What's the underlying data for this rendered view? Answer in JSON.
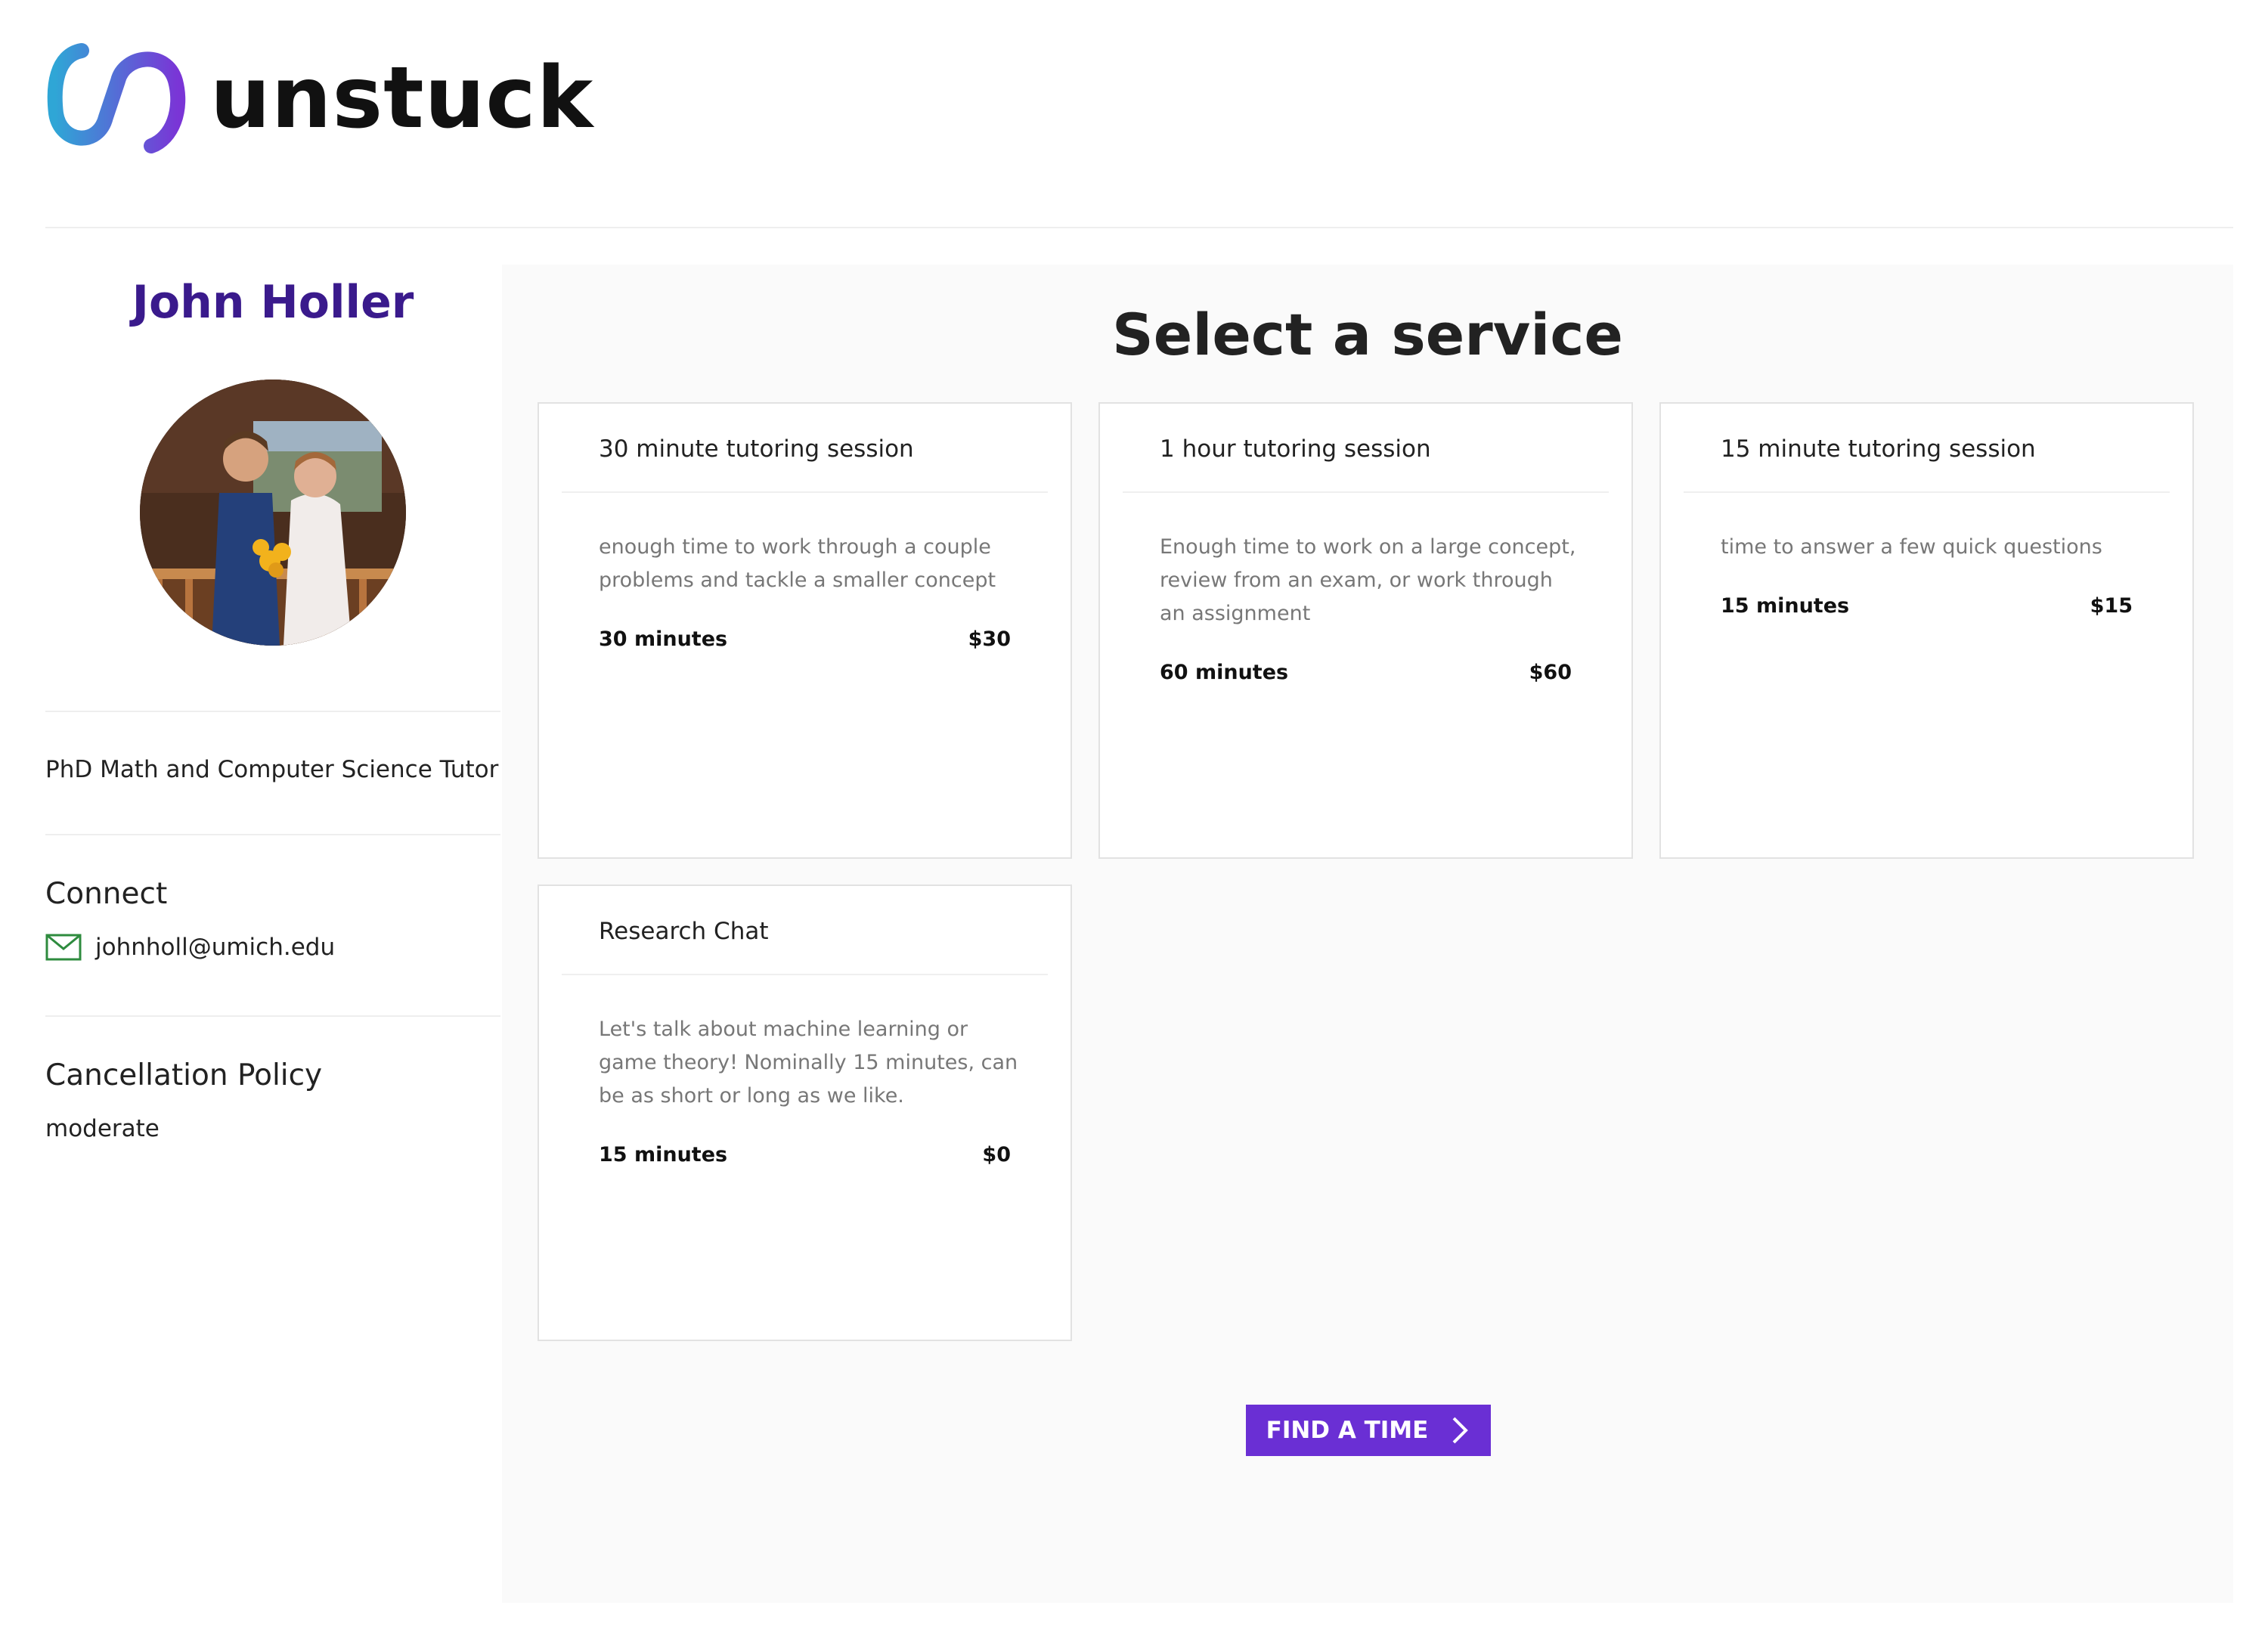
{
  "brand": {
    "name": "unstuck"
  },
  "profile": {
    "name": "John Holler",
    "tagline": "PhD Math and Computer Science Tutor",
    "connect_title": "Connect",
    "email": "johnholl@umich.edu",
    "cancellation_title": "Cancellation Policy",
    "cancellation_value": "moderate"
  },
  "main": {
    "title": "Select a service",
    "services": [
      {
        "title": "30 minute tutoring session",
        "description": "enough time to work through a couple problems and tackle a smaller concept",
        "duration": "30 minutes",
        "price": "$30"
      },
      {
        "title": "1 hour tutoring session",
        "description": "Enough time to work on a large concept, review from an exam, or work through an assignment",
        "duration": "60 minutes",
        "price": "$60"
      },
      {
        "title": "15 minute tutoring session",
        "description": "time to answer a few quick questions",
        "duration": "15 minutes",
        "price": "$15"
      },
      {
        "title": "Research Chat",
        "description": "Let's talk about machine learning or game theory! Nominally 15 minutes, can be as short or long as we like.",
        "duration": "15 minutes",
        "price": "$0"
      }
    ],
    "find_button_label": "FIND A TIME"
  },
  "colors": {
    "accent": "#6a2fd4",
    "name": "#3a1a8c",
    "mail_icon": "#2e8b3e"
  },
  "icons": {
    "logo": "unstuck-logo-icon",
    "email": "mail-icon",
    "button": "chevron-right-icon"
  }
}
